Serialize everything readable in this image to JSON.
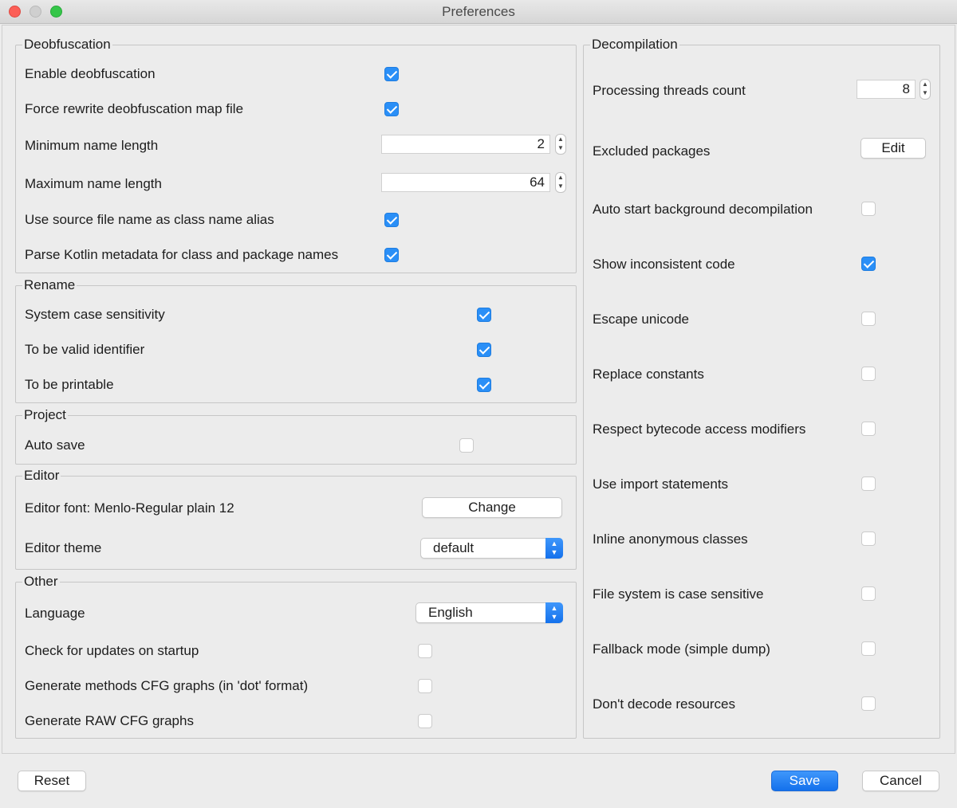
{
  "window": {
    "title": "Preferences"
  },
  "deobfuscation": {
    "legend": "Deobfuscation",
    "enable": {
      "label": "Enable deobfuscation",
      "checked": true
    },
    "force_rewrite": {
      "label": "Force rewrite deobfuscation map file",
      "checked": true
    },
    "min_name_length": {
      "label": "Minimum name length",
      "value": "2"
    },
    "max_name_length": {
      "label": "Maximum name length",
      "value": "64"
    },
    "use_source_name": {
      "label": "Use source file name as class name alias",
      "checked": true
    },
    "parse_kotlin": {
      "label": "Parse Kotlin metadata for class and package names",
      "checked": true
    }
  },
  "rename": {
    "legend": "Rename",
    "case_sensitivity": {
      "label": "System case sensitivity",
      "checked": true
    },
    "valid_identifier": {
      "label": "To be valid identifier",
      "checked": true
    },
    "printable": {
      "label": "To be printable",
      "checked": true
    }
  },
  "project": {
    "legend": "Project",
    "auto_save": {
      "label": "Auto save",
      "checked": false
    }
  },
  "editor": {
    "legend": "Editor",
    "font_label": "Editor font: Menlo-Regular plain 12",
    "change_button": "Change",
    "theme_label": "Editor theme",
    "theme_value": "default"
  },
  "other": {
    "legend": "Other",
    "language_label": "Language",
    "language_value": "English",
    "check_updates": {
      "label": "Check for updates on startup",
      "checked": false
    },
    "cfg_dot": {
      "label": "Generate methods CFG graphs (in 'dot' format)",
      "checked": false
    },
    "cfg_raw": {
      "label": "Generate RAW CFG graphs",
      "checked": false
    }
  },
  "decompilation": {
    "legend": "Decompilation",
    "threads_label": "Processing threads count",
    "threads_value": "8",
    "excluded_label": "Excluded packages",
    "edit_button": "Edit",
    "auto_start": {
      "label": "Auto start background decompilation",
      "checked": false
    },
    "show_inconsistent": {
      "label": "Show inconsistent code",
      "checked": true
    },
    "escape_unicode": {
      "label": "Escape unicode",
      "checked": false
    },
    "replace_constants": {
      "label": "Replace constants",
      "checked": false
    },
    "respect_bytecode": {
      "label": "Respect bytecode access modifiers",
      "checked": false
    },
    "use_imports": {
      "label": "Use import statements",
      "checked": false
    },
    "inline_anonymous": {
      "label": "Inline anonymous classes",
      "checked": false
    },
    "fs_case_sensitive": {
      "label": "File system is case sensitive",
      "checked": false
    },
    "fallback_mode": {
      "label": "Fallback mode (simple dump)",
      "checked": false
    },
    "dont_decode": {
      "label": "Don't decode resources",
      "checked": false
    }
  },
  "footer": {
    "reset": "Reset",
    "save": "Save",
    "cancel": "Cancel"
  }
}
